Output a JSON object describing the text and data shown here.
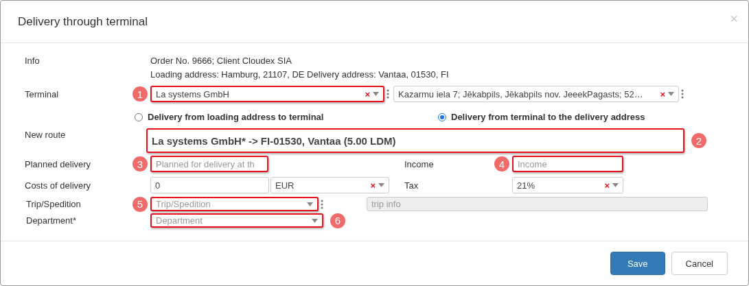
{
  "dialog": {
    "title": "Delivery through terminal",
    "close": "×"
  },
  "info": {
    "label": "Info",
    "lines": [
      "Order No. 9666; Client Cloudex SIA",
      "Loading address: Hamburg, 21107, DE Delivery address: Vantaa, 01530, FI"
    ]
  },
  "terminal": {
    "label": "Terminal",
    "fields": [
      {
        "kind": "select",
        "value": "La systems GmbH",
        "clear": "×",
        "menu": true,
        "highlighted": true,
        "callout": "1"
      },
      {
        "kind": "select",
        "value": "Kazarmu iela 7; Jēkabpils, Jēkabpils nov. JeeekPagasts; 52…",
        "clear": "×",
        "menu": true,
        "highlighted": false
      }
    ]
  },
  "direction": [
    {
      "label": "Delivery from loading address to terminal",
      "selected": false
    },
    {
      "label": "Delivery from terminal to the delivery address",
      "selected": true
    }
  ],
  "new_route": {
    "label": "New route",
    "value": "La systems GmbH* -> FI-01530, Vantaa (5.00 LDM)",
    "highlighted": true,
    "callout": "2"
  },
  "planned_delivery": {
    "label": "Planned delivery",
    "field": {
      "kind": "input",
      "placeholder": "Planned for delivery at th",
      "highlighted": true,
      "callout": "3"
    }
  },
  "income": {
    "label": "Income",
    "field": {
      "kind": "input",
      "placeholder": "Income",
      "highlighted": true,
      "callout": "4"
    }
  },
  "costs_of_delivery": {
    "label": "Costs of delivery",
    "fields": [
      {
        "kind": "input",
        "value": "0",
        "highlighted": false
      },
      {
        "kind": "select",
        "value": "EUR",
        "clear": "×",
        "highlighted": false
      }
    ]
  },
  "tax": {
    "label": "Tax",
    "field": {
      "kind": "select",
      "value": "21%",
      "clear": "×",
      "highlighted": false
    }
  },
  "trip": {
    "label": "Trip/Spedition",
    "fields": [
      {
        "kind": "select",
        "placeholder": "Trip/Spedition",
        "menu": true,
        "highlighted": true,
        "callout": "5"
      },
      {
        "kind": "disabled",
        "placeholder": "trip info",
        "highlighted": false
      }
    ]
  },
  "department": {
    "label": "Department*",
    "field": {
      "kind": "select",
      "placeholder": "Department",
      "highlighted": true,
      "callout": "6"
    }
  },
  "buttons": [
    {
      "label": "Save",
      "kind": "primary"
    },
    {
      "label": "Cancel",
      "kind": "default"
    }
  ]
}
